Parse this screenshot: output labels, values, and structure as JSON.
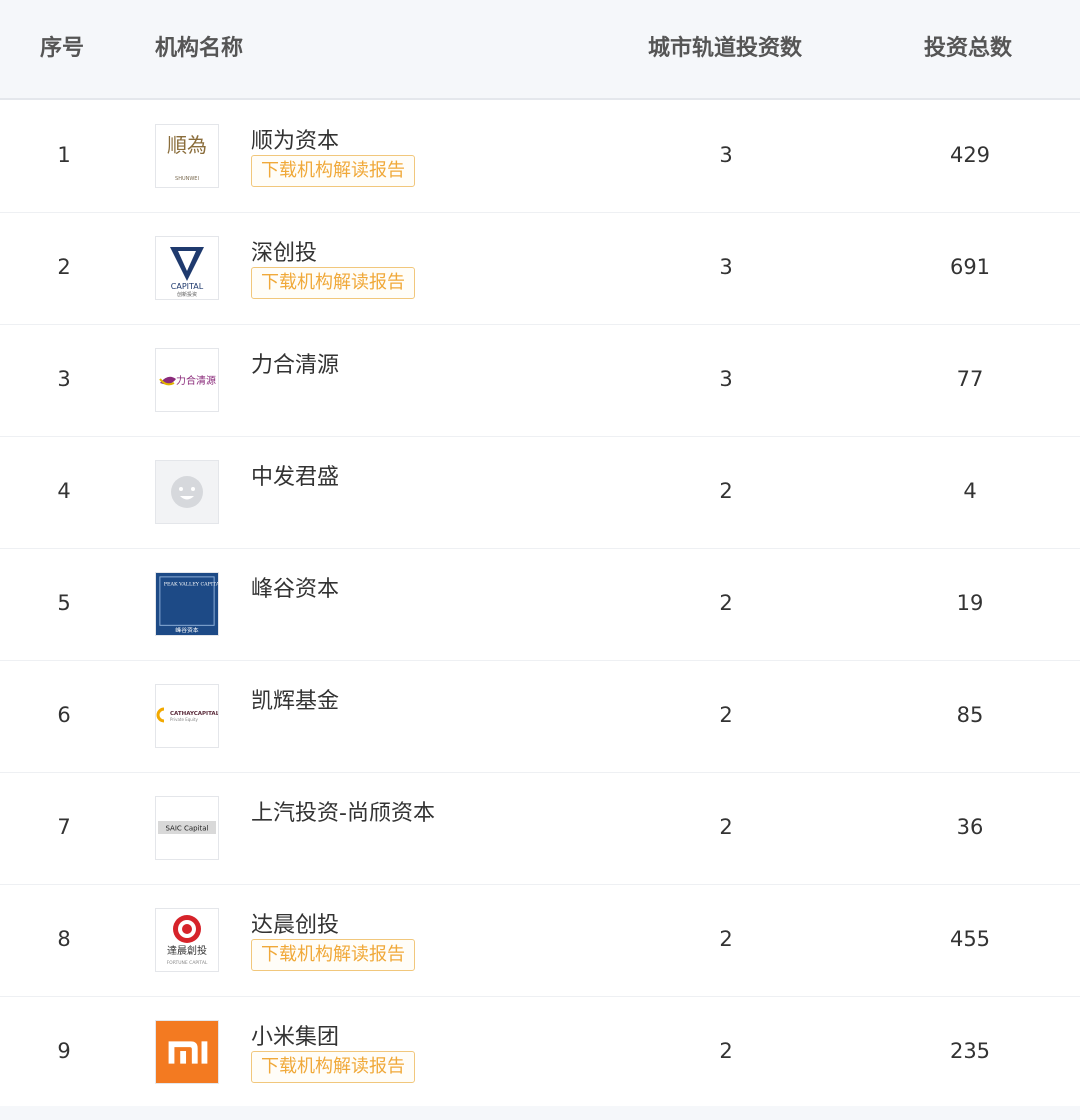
{
  "header": {
    "index_label": "序号",
    "name_label": "机构名称",
    "rail_count_label": "城市轨道投资数",
    "total_label": "投资总数"
  },
  "report_button_label": "下载机构解读报告",
  "rows": [
    {
      "index": "1",
      "name": "顺为资本",
      "rail": "3",
      "total": "429",
      "logo_text": "順為",
      "logo_sub": "SHUNWEI",
      "has_report": true,
      "logo_icon": "shunwei-logo-icon"
    },
    {
      "index": "2",
      "name": "深创投",
      "rail": "3",
      "total": "691",
      "logo_text": "CAPITAL",
      "logo_sub": "创新投资",
      "has_report": true,
      "logo_icon": "shenchuangtou-logo-icon"
    },
    {
      "index": "3",
      "name": "力合清源",
      "rail": "3",
      "total": "77",
      "logo_text": "力合清源",
      "logo_sub": "",
      "has_report": false,
      "logo_icon": "lihe-qingyuan-logo-icon"
    },
    {
      "index": "4",
      "name": "中发君盛",
      "rail": "2",
      "total": "4",
      "logo_text": "",
      "logo_sub": "",
      "has_report": false,
      "logo_icon": "placeholder-avatar-icon"
    },
    {
      "index": "5",
      "name": "峰谷资本",
      "rail": "2",
      "total": "19",
      "logo_text": "PEAK VALLEY CAPITAL",
      "logo_sub": "峰谷资本",
      "has_report": false,
      "logo_icon": "peak-valley-logo-icon"
    },
    {
      "index": "6",
      "name": "凯辉基金",
      "rail": "2",
      "total": "85",
      "logo_text": "CATHAYCAPITAL",
      "logo_sub": "Private Equity",
      "has_report": false,
      "logo_icon": "cathay-capital-logo-icon"
    },
    {
      "index": "7",
      "name": "上汽投资-尚颀资本",
      "rail": "2",
      "total": "36",
      "logo_text": "SAIC Capital",
      "logo_sub": "",
      "has_report": false,
      "logo_icon": "saic-capital-logo-icon"
    },
    {
      "index": "8",
      "name": "达晨创投",
      "rail": "2",
      "total": "455",
      "logo_text": "達晨創投",
      "logo_sub": "FORTUNE CAPITAL",
      "has_report": true,
      "logo_icon": "fortune-capital-logo-icon"
    },
    {
      "index": "9",
      "name": "小米集团",
      "rail": "2",
      "total": "235",
      "logo_text": "mi",
      "logo_sub": "",
      "has_report": true,
      "logo_icon": "xiaomi-logo-icon"
    }
  ],
  "colors": {
    "header_bg": "#f5f7fa",
    "report_border": "#f1c77c",
    "report_text": "#f0a93a",
    "xiaomi_orange": "#f37a21",
    "peak_valley_blue": "#1d4a86",
    "fortune_red": "#d6232a",
    "lihe_purple": "#8a2a7a"
  }
}
